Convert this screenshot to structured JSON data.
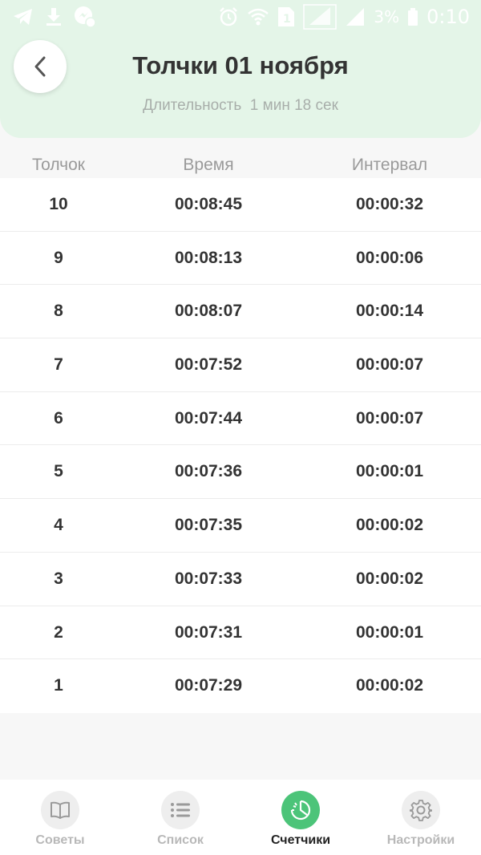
{
  "colors": {
    "header_bg": "#e4f5e8",
    "accent": "#4cc479",
    "muted_text": "#a8aeaa",
    "row_text": "#333333"
  },
  "status_bar": {
    "icons_left": [
      "telegram-icon",
      "download-icon",
      "messenger-icon"
    ],
    "icons_right": [
      "alarm-icon",
      "wifi-icon",
      "sim-1-icon",
      "signal-1-icon",
      "signal-2-icon",
      "battery-icon"
    ],
    "battery": "3%",
    "time": "0:10"
  },
  "header": {
    "back_icon": "chevron-left-icon",
    "title": "Толчки 01 ноября",
    "duration_label": "Длительность",
    "duration_value": "1 мин 18 сек",
    "subtitle": "Длительность  1 мин 18 сек"
  },
  "table": {
    "columns": [
      "Толчок",
      "Время",
      "Интервал"
    ],
    "rows": [
      {
        "num": "10",
        "time": "00:08:45",
        "interval": "00:00:32"
      },
      {
        "num": "9",
        "time": "00:08:13",
        "interval": "00:00:06"
      },
      {
        "num": "8",
        "time": "00:08:07",
        "interval": "00:00:14"
      },
      {
        "num": "7",
        "time": "00:07:52",
        "interval": "00:00:07"
      },
      {
        "num": "6",
        "time": "00:07:44",
        "interval": "00:00:07"
      },
      {
        "num": "5",
        "time": "00:07:36",
        "interval": "00:00:01"
      },
      {
        "num": "4",
        "time": "00:07:35",
        "interval": "00:00:02"
      },
      {
        "num": "3",
        "time": "00:07:33",
        "interval": "00:00:02"
      },
      {
        "num": "2",
        "time": "00:07:31",
        "interval": "00:00:01"
      },
      {
        "num": "1",
        "time": "00:07:29",
        "interval": "00:00:02"
      }
    ]
  },
  "bottom_nav": [
    {
      "label": "Советы",
      "icon": "book-icon",
      "active": false
    },
    {
      "label": "Список",
      "icon": "list-icon",
      "active": false
    },
    {
      "label": "Счетчики",
      "icon": "timer-icon",
      "active": true
    },
    {
      "label": "Настройки",
      "icon": "gear-icon",
      "active": false
    }
  ]
}
